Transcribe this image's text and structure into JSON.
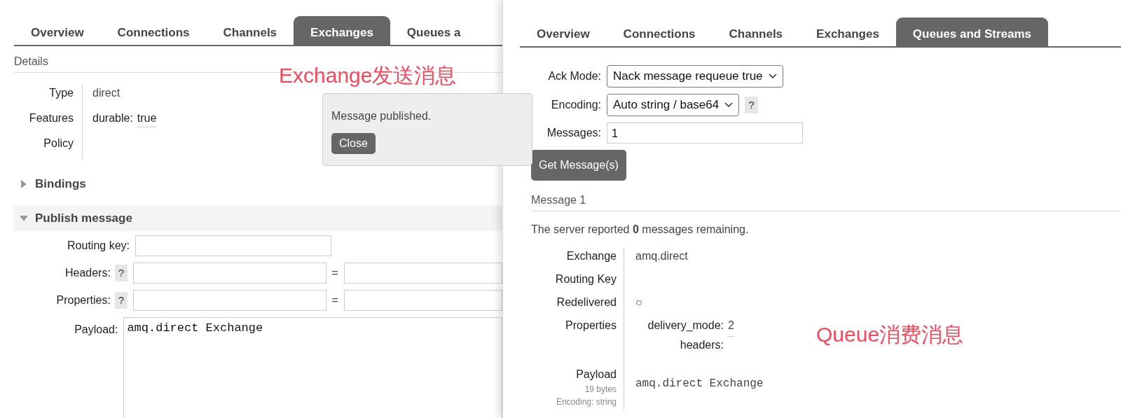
{
  "left_panel": {
    "tabs": [
      {
        "label": "Overview",
        "selected": false
      },
      {
        "label": "Connections",
        "selected": false
      },
      {
        "label": "Channels",
        "selected": false
      },
      {
        "label": "Exchanges",
        "selected": true
      },
      {
        "label": "Queues a",
        "selected": false
      }
    ],
    "details_heading": "Details",
    "details": [
      {
        "label": "Type",
        "value": "direct"
      },
      {
        "label": "Features",
        "key": "durable:",
        "value": "true"
      },
      {
        "label": "Policy"
      }
    ],
    "notification": {
      "text": "Message published.",
      "button": "Close"
    },
    "sections": [
      {
        "title": "Bindings",
        "expanded": false
      },
      {
        "title": "Publish message",
        "expanded": true
      }
    ],
    "form": {
      "routing_key": {
        "label": "Routing key:"
      },
      "headers": {
        "label": "Headers:",
        "help": "?",
        "separator": "="
      },
      "properties": {
        "label": "Properties:",
        "help": "?",
        "separator": "="
      },
      "payload": {
        "label": "Payload:",
        "value": "amq.direct Exchange"
      }
    }
  },
  "right_panel": {
    "tabs": [
      {
        "label": "Overview",
        "selected": false
      },
      {
        "label": "Connections",
        "selected": false
      },
      {
        "label": "Channels",
        "selected": false
      },
      {
        "label": "Exchanges",
        "selected": false
      },
      {
        "label": "Queues and Streams",
        "selected": true
      }
    ],
    "ack_mode": {
      "label": "Ack Mode:",
      "value": "Nack message requeue true"
    },
    "encoding": {
      "label": "Encoding:",
      "value": "Auto string / base64",
      "help": "?"
    },
    "messages": {
      "label": "Messages:",
      "value": "1"
    },
    "button": "Get Message(s)",
    "message_heading": "Message 1",
    "summary": "The server reported **0** messages remaining.",
    "fields": [
      {
        "label": "Exchange",
        "value": "amq.direct"
      },
      {
        "label": "Routing Key"
      },
      {
        "label": "Redelivered",
        "value": "○"
      },
      {
        "label": "Properties",
        "properties": [
          {
            "key": "delivery_mode:",
            "value": "2"
          },
          {
            "key": "headers:"
          }
        ]
      },
      {
        "label": "Payload",
        "notes": [
          "19 bytes",
          "Encoding: string"
        ],
        "value": "amq.direct Exchange",
        "mono": true
      }
    ]
  },
  "annotations": [
    {
      "text": "Exchange发送消息",
      "color": "#f2495c"
    },
    {
      "text": "Queue消费消息",
      "color": "#f2495c"
    }
  ]
}
